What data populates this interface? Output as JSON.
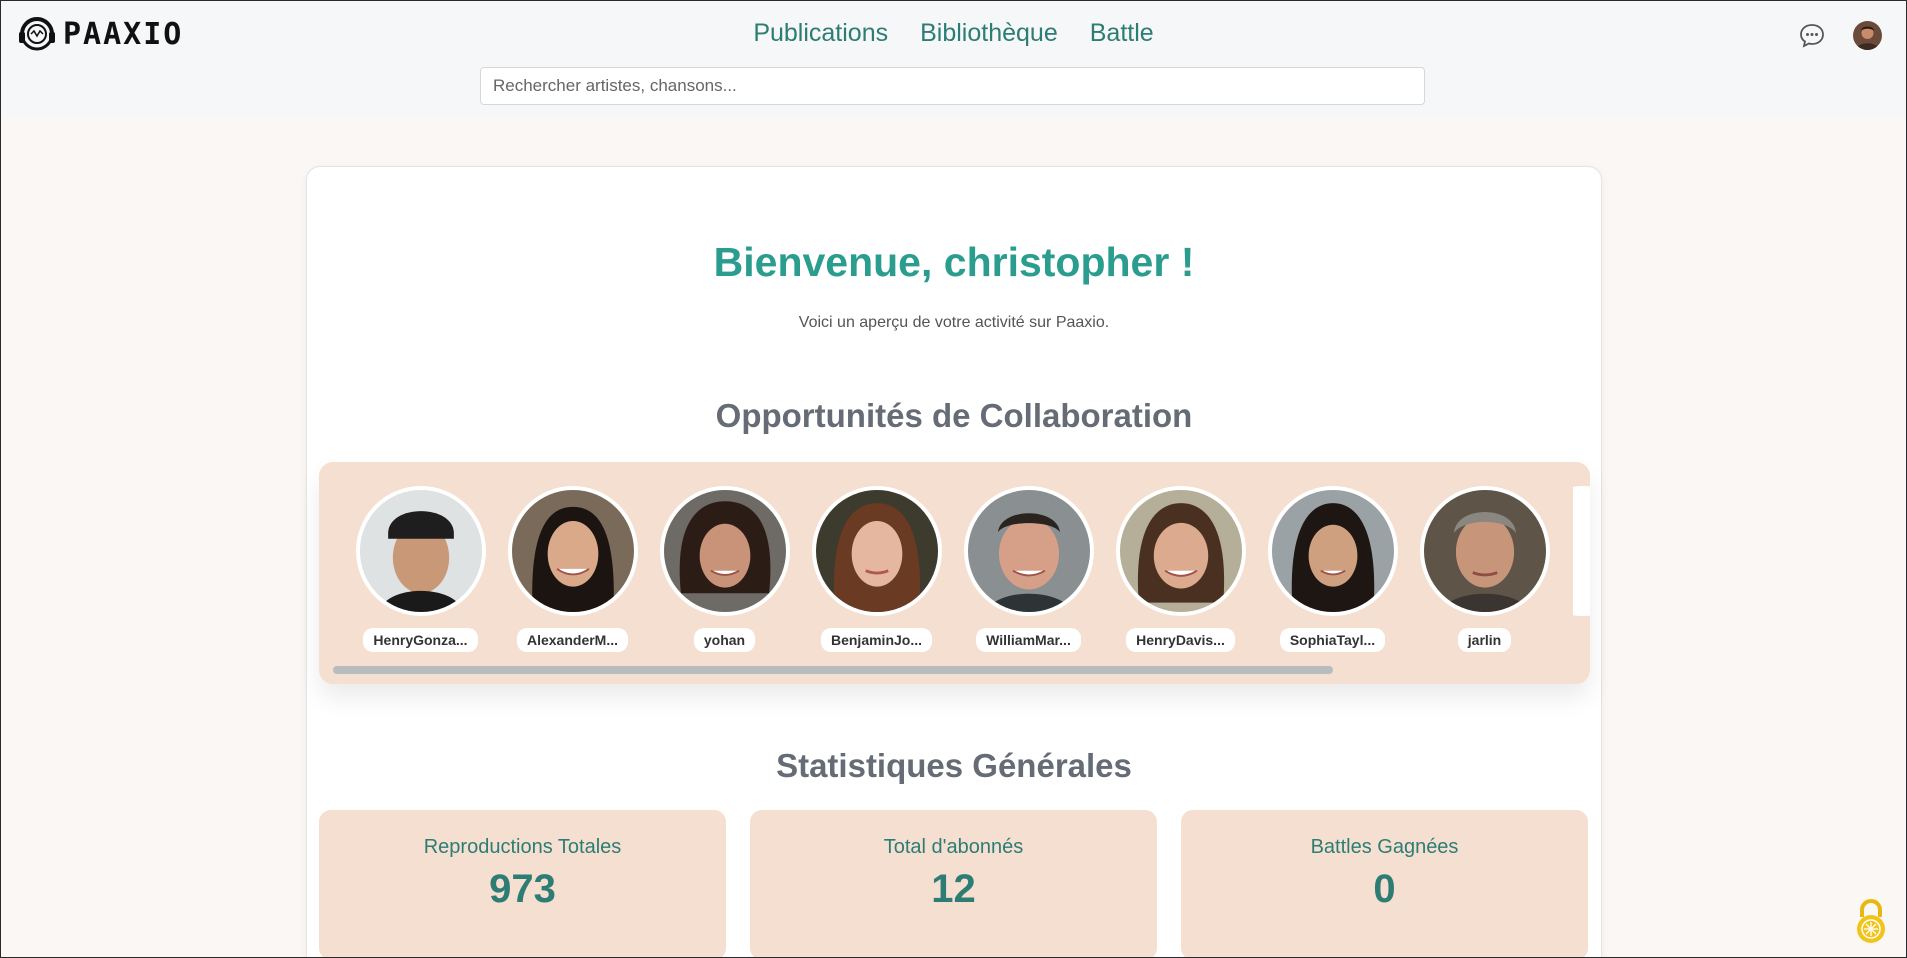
{
  "header": {
    "logo_text": "PAAXIO",
    "nav": [
      {
        "label": "Publications"
      },
      {
        "label": "Bibliothèque"
      },
      {
        "label": "Battle"
      }
    ],
    "search_placeholder": "Rechercher artistes, chansons..."
  },
  "main": {
    "welcome": "Bienvenue, christopher !",
    "subtitle": "Voici un aperçu de votre activité sur Paaxio.",
    "collab_title": "Opportunités de Collaboration",
    "collaborators": [
      {
        "name": "HenryGonza..."
      },
      {
        "name": "AlexanderM..."
      },
      {
        "name": "yohan"
      },
      {
        "name": "BenjaminJo..."
      },
      {
        "name": "WilliamMar..."
      },
      {
        "name": "HenryDavis..."
      },
      {
        "name": "SophiaTayl..."
      },
      {
        "name": "jarlin"
      }
    ],
    "stats_title": "Statistiques Générales",
    "stats": [
      {
        "label": "Reproductions Totales",
        "value": "973"
      },
      {
        "label": "Total d'abonnés",
        "value": "12"
      },
      {
        "label": "Battles Gagnées",
        "value": "0"
      }
    ]
  },
  "colors": {
    "accent": "#2a9d8f",
    "accent_dark": "#2d7d74",
    "panel": "#f5dfd1"
  },
  "icons": [
    "logo-icon",
    "chat-icon",
    "avatar",
    "lock-icon"
  ]
}
